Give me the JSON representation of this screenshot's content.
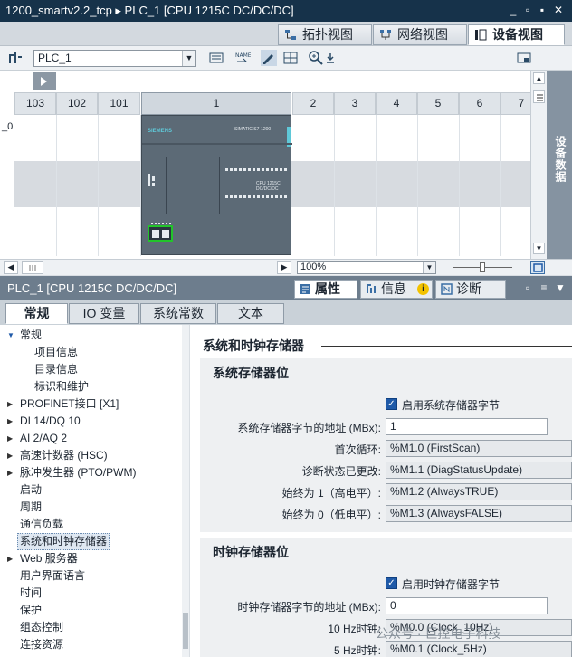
{
  "window": {
    "title": "1200_smartv2.2_tcp  ▸  PLC_1 [CPU 1215C DC/DC/DC]",
    "controls": [
      "_",
      "▫",
      "▪",
      "✕"
    ]
  },
  "view_tabs": [
    {
      "label": "拓扑视图",
      "icon": "topology-icon"
    },
    {
      "label": "网络视图",
      "icon": "network-icon"
    },
    {
      "label": "设备视图",
      "icon": "device-icon"
    }
  ],
  "toolbar": {
    "device_select": "PLC_1"
  },
  "device_view": {
    "rack_left_label": "_0",
    "slot_headers": [
      "103",
      "102",
      "101",
      "1",
      "2",
      "3",
      "4",
      "5",
      "6",
      "7"
    ],
    "cpu_brand": "SIEMENS",
    "cpu_model_text": "SIMATIC S7-1200",
    "cpu_type_text": "CPU 1215C DC/DC/DC",
    "sidebar_tab": "设备数据",
    "zoom": "100%"
  },
  "inspector": {
    "title": "PLC_1 [CPU 1215C DC/DC/DC]",
    "tabs": [
      {
        "label": "属性",
        "icon": "properties-icon"
      },
      {
        "label": "信息",
        "icon": "info-icon"
      },
      {
        "label": "诊断",
        "icon": "diagnostics-icon"
      }
    ],
    "subtabs": [
      "常规",
      "IO 变量",
      "系统常数",
      "文本"
    ]
  },
  "nav": {
    "items": [
      {
        "label": "常规",
        "indent": 0,
        "arrow": "down"
      },
      {
        "label": "项目信息",
        "indent": 2,
        "arrow": ""
      },
      {
        "label": "目录信息",
        "indent": 2,
        "arrow": ""
      },
      {
        "label": "标识和维护",
        "indent": 2,
        "arrow": ""
      },
      {
        "label": "PROFINET接口 [X1]",
        "indent": 0,
        "arrow": "right"
      },
      {
        "label": "DI 14/DQ 10",
        "indent": 0,
        "arrow": "right"
      },
      {
        "label": "AI 2/AQ 2",
        "indent": 0,
        "arrow": "right"
      },
      {
        "label": "高速计数器 (HSC)",
        "indent": 0,
        "arrow": "right"
      },
      {
        "label": "脉冲发生器 (PTO/PWM)",
        "indent": 0,
        "arrow": "right"
      },
      {
        "label": "启动",
        "indent": 0,
        "arrow": ""
      },
      {
        "label": "周期",
        "indent": 0,
        "arrow": ""
      },
      {
        "label": "通信负载",
        "indent": 0,
        "arrow": ""
      },
      {
        "label": "系统和时钟存储器",
        "indent": 0,
        "arrow": "",
        "selected": true
      },
      {
        "label": "Web 服务器",
        "indent": 0,
        "arrow": "right"
      },
      {
        "label": "用户界面语言",
        "indent": 0,
        "arrow": ""
      },
      {
        "label": "时间",
        "indent": 0,
        "arrow": ""
      },
      {
        "label": "保护",
        "indent": 0,
        "arrow": ""
      },
      {
        "label": "组态控制",
        "indent": 0,
        "arrow": ""
      },
      {
        "label": "连接资源",
        "indent": 0,
        "arrow": ""
      }
    ]
  },
  "content": {
    "section_title": "系统和时钟存储器",
    "system_group": {
      "title": "系统存储器位",
      "enable_label": "启用系统存储器字节",
      "address_label": "系统存储器字节的地址 (MBx):",
      "address_value": "1",
      "rows": [
        {
          "label": "首次循环:",
          "value": "%M1.0 (FirstScan)"
        },
        {
          "label": "诊断状态已更改:",
          "value": "%M1.1 (DiagStatusUpdate)"
        },
        {
          "label": "始终为 1（高电平）:",
          "value": "%M1.2 (AlwaysTRUE)"
        },
        {
          "label": "始终为 0（低电平）:",
          "value": "%M1.3 (AlwaysFALSE)"
        }
      ]
    },
    "clock_group": {
      "title": "时钟存储器位",
      "enable_label": "启用时钟存储器字节",
      "address_label": "时钟存储器字节的地址 (MBx):",
      "address_value": "0",
      "rows": [
        {
          "label": "10 Hz时钟:",
          "value": "%M0.0 (Clock_10Hz)"
        },
        {
          "label": "5 Hz时钟:",
          "value": "%M0.1 (Clock_5Hz)"
        }
      ]
    }
  },
  "watermark": "公众号 · 巨控电子科技"
}
